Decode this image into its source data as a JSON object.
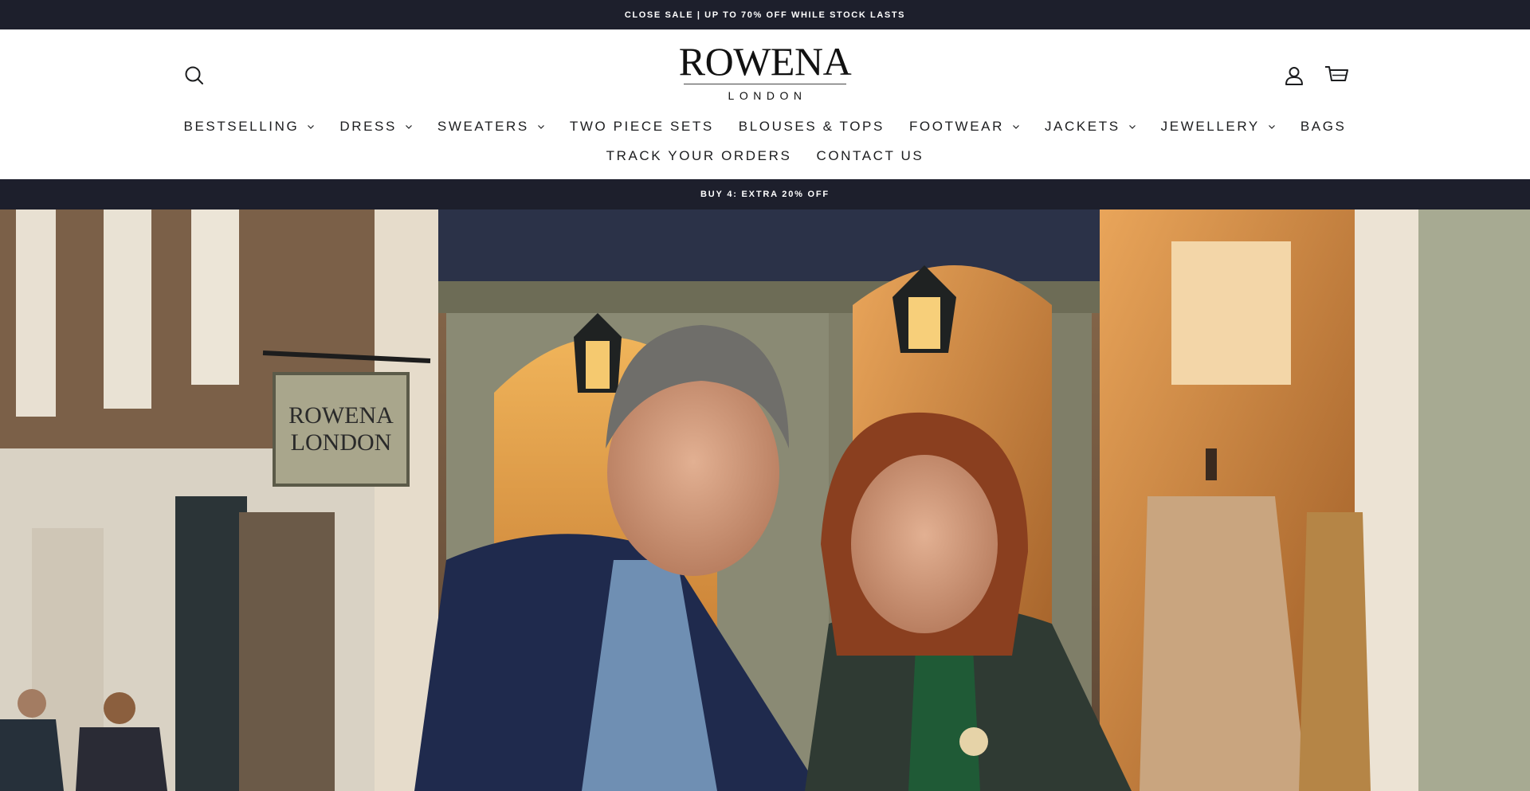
{
  "announcement": {
    "text": "CLOSE SALE | UP TO 70% OFF WHILE STOCK LASTS"
  },
  "header": {
    "logo": {
      "main": "ROWENA",
      "sub": "LONDON"
    },
    "icons": {
      "search": "search-icon",
      "account": "user-icon",
      "cart": "cart-icon"
    }
  },
  "nav": {
    "row1": [
      {
        "label": "BESTSELLING",
        "dropdown": true
      },
      {
        "label": "DRESS",
        "dropdown": true
      },
      {
        "label": "SWEATERS",
        "dropdown": true
      },
      {
        "label": "TWO PIECE SETS",
        "dropdown": false
      },
      {
        "label": "BLOUSES & TOPS",
        "dropdown": false
      },
      {
        "label": "FOOTWEAR",
        "dropdown": true
      },
      {
        "label": "JACKETS",
        "dropdown": true
      },
      {
        "label": "JEWELLERY",
        "dropdown": true
      },
      {
        "label": "BAGS",
        "dropdown": false
      }
    ],
    "row2": [
      {
        "label": "TRACK YOUR ORDERS",
        "dropdown": false
      },
      {
        "label": "CONTACT US",
        "dropdown": false
      }
    ]
  },
  "promo": {
    "text": "BUY 4: EXTRA 20% OFF"
  },
  "hero": {
    "shop_sign": {
      "line1": "ROWENA",
      "line2": "LONDON"
    }
  },
  "colors": {
    "bar_background": "#1d1f2c",
    "bar_text": "#ffffff",
    "nav_text": "#1c1d1f"
  }
}
